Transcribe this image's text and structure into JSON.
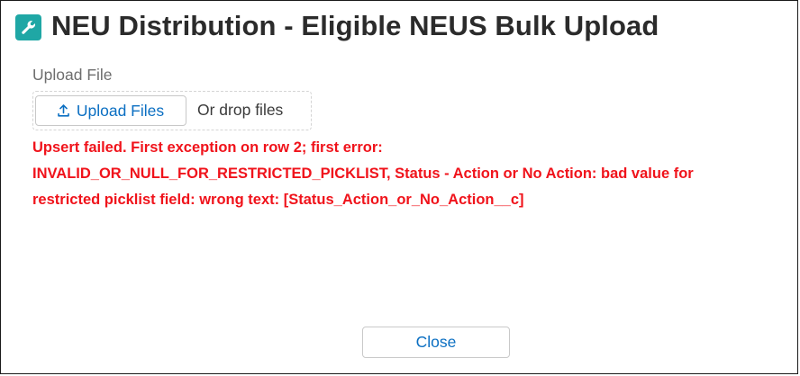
{
  "modal": {
    "title": "NEU Distribution - Eligible NEUS Bulk Upload",
    "title_icon": "wrench-icon",
    "accent_color": "#1fa7a5"
  },
  "upload": {
    "label": "Upload File",
    "button_label": "Upload Files",
    "button_icon": "upload-icon",
    "drop_text": "Or drop files"
  },
  "error": {
    "color": "#f0131b",
    "lines": [
      "Upsert failed. First exception on row 2; first error:",
      "INVALID_OR_NULL_FOR_RESTRICTED_PICKLIST, Status - Action or No Action: bad value for",
      "restricted picklist field: wrong text: [Status_Action_or_No_Action__c]"
    ]
  },
  "footer": {
    "close_label": "Close"
  }
}
